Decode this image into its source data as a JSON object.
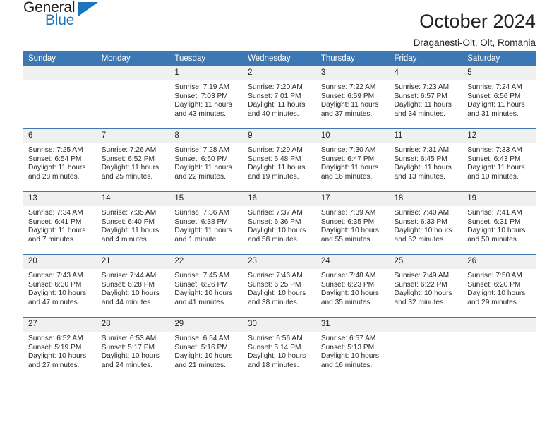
{
  "brand": {
    "word_one": "General",
    "word_two": "Blue",
    "logo_icon": "triangle-logo-icon"
  },
  "header": {
    "title": "October 2024",
    "subtitle": "Draganesti-Olt, Olt, Romania"
  },
  "colors": {
    "header_blue": "#3c78b4",
    "brand_blue": "#1c75bc",
    "daynum_band": "#f0f0f0",
    "text": "#222222"
  },
  "weekdays": [
    "Sunday",
    "Monday",
    "Tuesday",
    "Wednesday",
    "Thursday",
    "Friday",
    "Saturday"
  ],
  "weeks": [
    [
      {
        "day": "",
        "sunrise": "",
        "sunset": "",
        "daylight": ""
      },
      {
        "day": "",
        "sunrise": "",
        "sunset": "",
        "daylight": ""
      },
      {
        "day": "1",
        "sunrise": "Sunrise: 7:19 AM",
        "sunset": "Sunset: 7:03 PM",
        "daylight": "Daylight: 11 hours and 43 minutes."
      },
      {
        "day": "2",
        "sunrise": "Sunrise: 7:20 AM",
        "sunset": "Sunset: 7:01 PM",
        "daylight": "Daylight: 11 hours and 40 minutes."
      },
      {
        "day": "3",
        "sunrise": "Sunrise: 7:22 AM",
        "sunset": "Sunset: 6:59 PM",
        "daylight": "Daylight: 11 hours and 37 minutes."
      },
      {
        "day": "4",
        "sunrise": "Sunrise: 7:23 AM",
        "sunset": "Sunset: 6:57 PM",
        "daylight": "Daylight: 11 hours and 34 minutes."
      },
      {
        "day": "5",
        "sunrise": "Sunrise: 7:24 AM",
        "sunset": "Sunset: 6:56 PM",
        "daylight": "Daylight: 11 hours and 31 minutes."
      }
    ],
    [
      {
        "day": "6",
        "sunrise": "Sunrise: 7:25 AM",
        "sunset": "Sunset: 6:54 PM",
        "daylight": "Daylight: 11 hours and 28 minutes."
      },
      {
        "day": "7",
        "sunrise": "Sunrise: 7:26 AM",
        "sunset": "Sunset: 6:52 PM",
        "daylight": "Daylight: 11 hours and 25 minutes."
      },
      {
        "day": "8",
        "sunrise": "Sunrise: 7:28 AM",
        "sunset": "Sunset: 6:50 PM",
        "daylight": "Daylight: 11 hours and 22 minutes."
      },
      {
        "day": "9",
        "sunrise": "Sunrise: 7:29 AM",
        "sunset": "Sunset: 6:48 PM",
        "daylight": "Daylight: 11 hours and 19 minutes."
      },
      {
        "day": "10",
        "sunrise": "Sunrise: 7:30 AM",
        "sunset": "Sunset: 6:47 PM",
        "daylight": "Daylight: 11 hours and 16 minutes."
      },
      {
        "day": "11",
        "sunrise": "Sunrise: 7:31 AM",
        "sunset": "Sunset: 6:45 PM",
        "daylight": "Daylight: 11 hours and 13 minutes."
      },
      {
        "day": "12",
        "sunrise": "Sunrise: 7:33 AM",
        "sunset": "Sunset: 6:43 PM",
        "daylight": "Daylight: 11 hours and 10 minutes."
      }
    ],
    [
      {
        "day": "13",
        "sunrise": "Sunrise: 7:34 AM",
        "sunset": "Sunset: 6:41 PM",
        "daylight": "Daylight: 11 hours and 7 minutes."
      },
      {
        "day": "14",
        "sunrise": "Sunrise: 7:35 AM",
        "sunset": "Sunset: 6:40 PM",
        "daylight": "Daylight: 11 hours and 4 minutes."
      },
      {
        "day": "15",
        "sunrise": "Sunrise: 7:36 AM",
        "sunset": "Sunset: 6:38 PM",
        "daylight": "Daylight: 11 hours and 1 minute."
      },
      {
        "day": "16",
        "sunrise": "Sunrise: 7:37 AM",
        "sunset": "Sunset: 6:36 PM",
        "daylight": "Daylight: 10 hours and 58 minutes."
      },
      {
        "day": "17",
        "sunrise": "Sunrise: 7:39 AM",
        "sunset": "Sunset: 6:35 PM",
        "daylight": "Daylight: 10 hours and 55 minutes."
      },
      {
        "day": "18",
        "sunrise": "Sunrise: 7:40 AM",
        "sunset": "Sunset: 6:33 PM",
        "daylight": "Daylight: 10 hours and 52 minutes."
      },
      {
        "day": "19",
        "sunrise": "Sunrise: 7:41 AM",
        "sunset": "Sunset: 6:31 PM",
        "daylight": "Daylight: 10 hours and 50 minutes."
      }
    ],
    [
      {
        "day": "20",
        "sunrise": "Sunrise: 7:43 AM",
        "sunset": "Sunset: 6:30 PM",
        "daylight": "Daylight: 10 hours and 47 minutes."
      },
      {
        "day": "21",
        "sunrise": "Sunrise: 7:44 AM",
        "sunset": "Sunset: 6:28 PM",
        "daylight": "Daylight: 10 hours and 44 minutes."
      },
      {
        "day": "22",
        "sunrise": "Sunrise: 7:45 AM",
        "sunset": "Sunset: 6:26 PM",
        "daylight": "Daylight: 10 hours and 41 minutes."
      },
      {
        "day": "23",
        "sunrise": "Sunrise: 7:46 AM",
        "sunset": "Sunset: 6:25 PM",
        "daylight": "Daylight: 10 hours and 38 minutes."
      },
      {
        "day": "24",
        "sunrise": "Sunrise: 7:48 AM",
        "sunset": "Sunset: 6:23 PM",
        "daylight": "Daylight: 10 hours and 35 minutes."
      },
      {
        "day": "25",
        "sunrise": "Sunrise: 7:49 AM",
        "sunset": "Sunset: 6:22 PM",
        "daylight": "Daylight: 10 hours and 32 minutes."
      },
      {
        "day": "26",
        "sunrise": "Sunrise: 7:50 AM",
        "sunset": "Sunset: 6:20 PM",
        "daylight": "Daylight: 10 hours and 29 minutes."
      }
    ],
    [
      {
        "day": "27",
        "sunrise": "Sunrise: 6:52 AM",
        "sunset": "Sunset: 5:19 PM",
        "daylight": "Daylight: 10 hours and 27 minutes."
      },
      {
        "day": "28",
        "sunrise": "Sunrise: 6:53 AM",
        "sunset": "Sunset: 5:17 PM",
        "daylight": "Daylight: 10 hours and 24 minutes."
      },
      {
        "day": "29",
        "sunrise": "Sunrise: 6:54 AM",
        "sunset": "Sunset: 5:16 PM",
        "daylight": "Daylight: 10 hours and 21 minutes."
      },
      {
        "day": "30",
        "sunrise": "Sunrise: 6:56 AM",
        "sunset": "Sunset: 5:14 PM",
        "daylight": "Daylight: 10 hours and 18 minutes."
      },
      {
        "day": "31",
        "sunrise": "Sunrise: 6:57 AM",
        "sunset": "Sunset: 5:13 PM",
        "daylight": "Daylight: 10 hours and 16 minutes."
      },
      {
        "day": "",
        "sunrise": "",
        "sunset": "",
        "daylight": ""
      },
      {
        "day": "",
        "sunrise": "",
        "sunset": "",
        "daylight": ""
      }
    ]
  ]
}
